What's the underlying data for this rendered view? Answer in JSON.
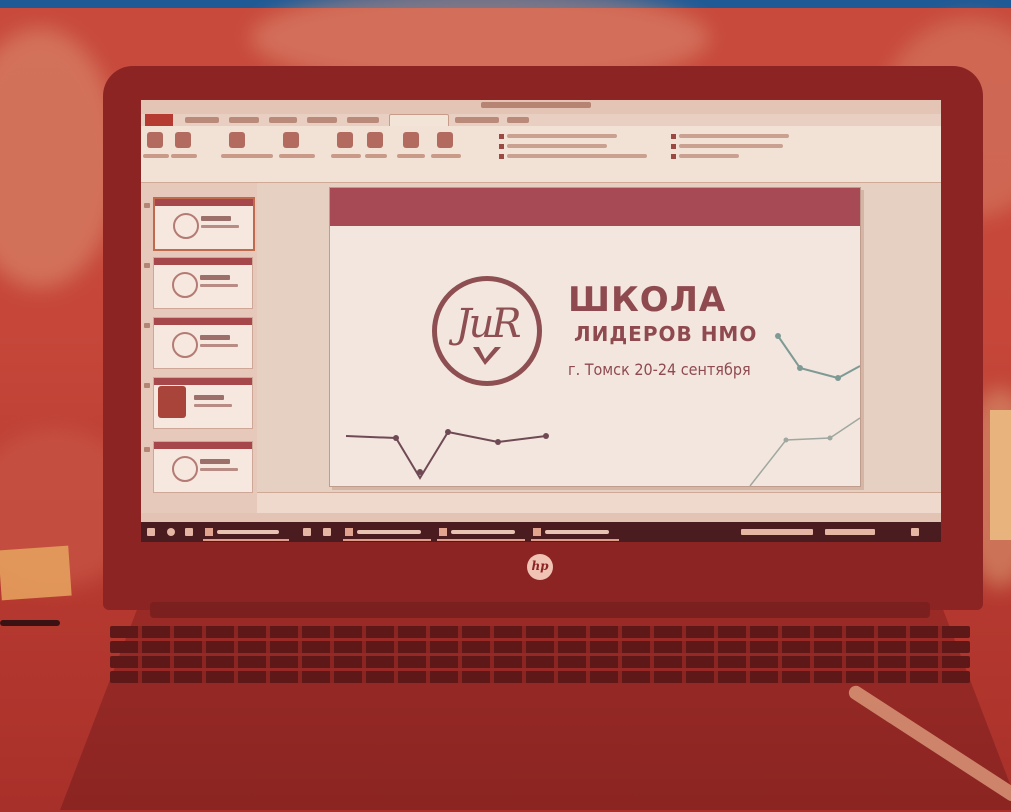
{
  "slide": {
    "logo_text": "JuR",
    "title": "ШКОЛА",
    "subtitle": "ЛИДЕРОВ НМО",
    "date_line": "г. Томск 20-24 сентября"
  },
  "laptop": {
    "brand_logo": "hp"
  },
  "colors": {
    "overlay_tint": "#b8332d",
    "top_bar": "#1f5a96",
    "slide_accent": "#a84a55"
  },
  "icons": [
    "hp-logo-icon",
    "windows-start-icon",
    "search-icon",
    "task-view-icon",
    "powerpoint-icon",
    "file-explorer-icon"
  ]
}
